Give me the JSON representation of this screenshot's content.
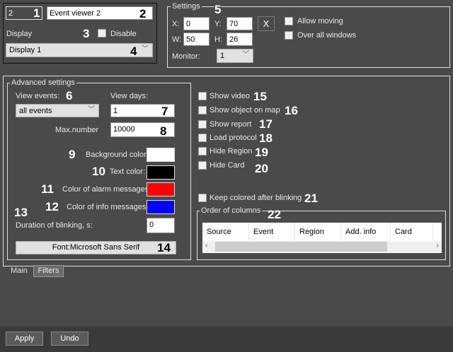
{
  "top": {
    "id_value": "2",
    "name_value": "Event viewer 2",
    "display_label": "Display",
    "disable_label": "Disable",
    "display_select": "Display 1",
    "markers": [
      "1",
      "2",
      "3",
      "4"
    ]
  },
  "settings": {
    "title": "Settings",
    "marker": "5",
    "x_label": "X:",
    "x_value": "0",
    "y_label": "Y:",
    "y_value": "70",
    "w_label": "W:",
    "w_value": "50",
    "h_label": "H:",
    "h_value": "26",
    "close_label": "X",
    "allow_moving": "Allow moving",
    "over_all": "Over all windows",
    "monitor_label": "Monitor:",
    "monitor_value": "1"
  },
  "advanced": {
    "title": "Advanced settings",
    "view_events_label": "View events:",
    "view_events_value": "all events",
    "view_days_label": "View days:",
    "view_days_value": "1",
    "max_label": "Max.number",
    "max_value": "10000",
    "bg_label": "Background color:",
    "text_label": "Text color:",
    "alarm_label": "Color of alarm messages:",
    "info_label": "Color of info messages:",
    "duration_label": "Duration of blinking, s:",
    "duration_value": "0",
    "font_button": "Font:Microsoft Sans Serif",
    "colors": {
      "background": "#ffffff",
      "text": "#000000",
      "alarm": "#ff0000",
      "info": "#0000ff"
    },
    "markers": [
      "6",
      "7",
      "8",
      "9",
      "10",
      "11",
      "12",
      "13",
      "14"
    ]
  },
  "options": {
    "show_video": "Show video",
    "show_map": "Show object on map",
    "show_report": "Show report",
    "load_protocol": "Load protocol",
    "hide_region": "Hide Region",
    "hide_card": "Hide Card",
    "keep_colored": "Keep colored after blinking",
    "markers": [
      "15",
      "16",
      "17",
      "18",
      "19",
      "20",
      "21"
    ]
  },
  "columns": {
    "title": "Order of columns",
    "marker": "22",
    "headers": [
      "Source",
      "Event",
      "Region",
      "Add. info",
      "Card"
    ]
  },
  "tabs": [
    "Main",
    "Filters"
  ],
  "footer": {
    "apply": "Apply",
    "undo": "Undo"
  }
}
